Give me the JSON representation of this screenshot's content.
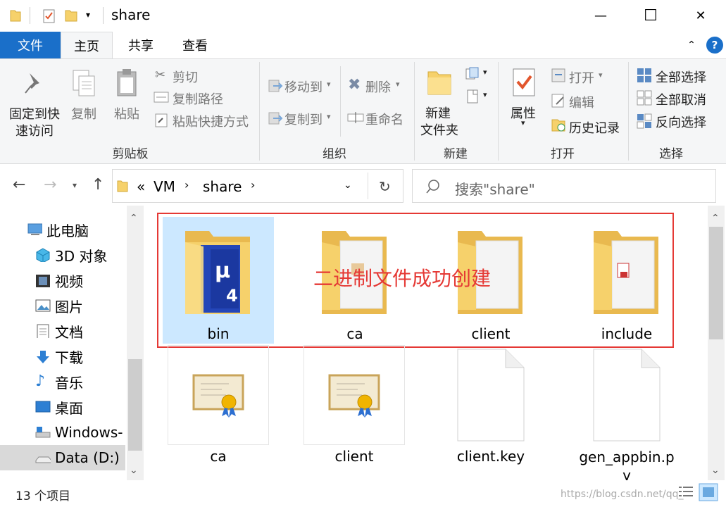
{
  "window": {
    "title": "share",
    "minimize": "—",
    "maximize": "☐",
    "close": "✕"
  },
  "tabs": {
    "file": "文件",
    "home": "主页",
    "share": "共享",
    "view": "查看",
    "help": "?"
  },
  "ribbon": {
    "clipboard": {
      "pin": "固定到快\n速访问",
      "pin1": "固定到快",
      "pin2": "速访问",
      "copy": "复制",
      "paste": "粘贴",
      "cut": "剪切",
      "copy_path": "复制路径",
      "paste_shortcut": "粘贴快捷方式",
      "group": "剪贴板"
    },
    "organize": {
      "move_to": "移动到",
      "copy_to": "复制到",
      "delete": "删除",
      "rename": "重命名",
      "group": "组织"
    },
    "new": {
      "new_folder1": "新建",
      "new_folder2": "文件夹",
      "group": "新建"
    },
    "open": {
      "properties": "属性",
      "open": "打开",
      "edit": "编辑",
      "history": "历史记录",
      "group": "打开"
    },
    "select": {
      "select_all": "全部选择",
      "select_none": "全部取消",
      "invert": "反向选择",
      "group": "选择"
    }
  },
  "address": {
    "crumbs": [
      "«",
      "VM",
      "share"
    ],
    "search_placeholder": "搜索\"share\""
  },
  "nav": {
    "items": [
      "此电脑",
      "3D 对象",
      "视频",
      "图片",
      "文档",
      "下载",
      "音乐",
      "桌面",
      "Windows-",
      "Data (D:)"
    ]
  },
  "files": [
    {
      "name": "bin",
      "type": "folder-app"
    },
    {
      "name": "ca",
      "type": "folder-doc"
    },
    {
      "name": "client",
      "type": "folder-doc"
    },
    {
      "name": "include",
      "type": "folder-doc"
    },
    {
      "name": "ca",
      "type": "certificate"
    },
    {
      "name": "client",
      "type": "certificate"
    },
    {
      "name": "client.key",
      "type": "file"
    },
    {
      "name": "gen_appbin.p\ny",
      "type": "file"
    }
  ],
  "annotation": {
    "text": "二进制文件成功创建",
    "color": "#e53935"
  },
  "status": {
    "count": "13 个项目",
    "watermark": "https://blog.csdn.net/qq_"
  },
  "colors": {
    "accent": "#1a6fc9",
    "selection": "#cce8ff",
    "folder": "#f6d16b"
  }
}
